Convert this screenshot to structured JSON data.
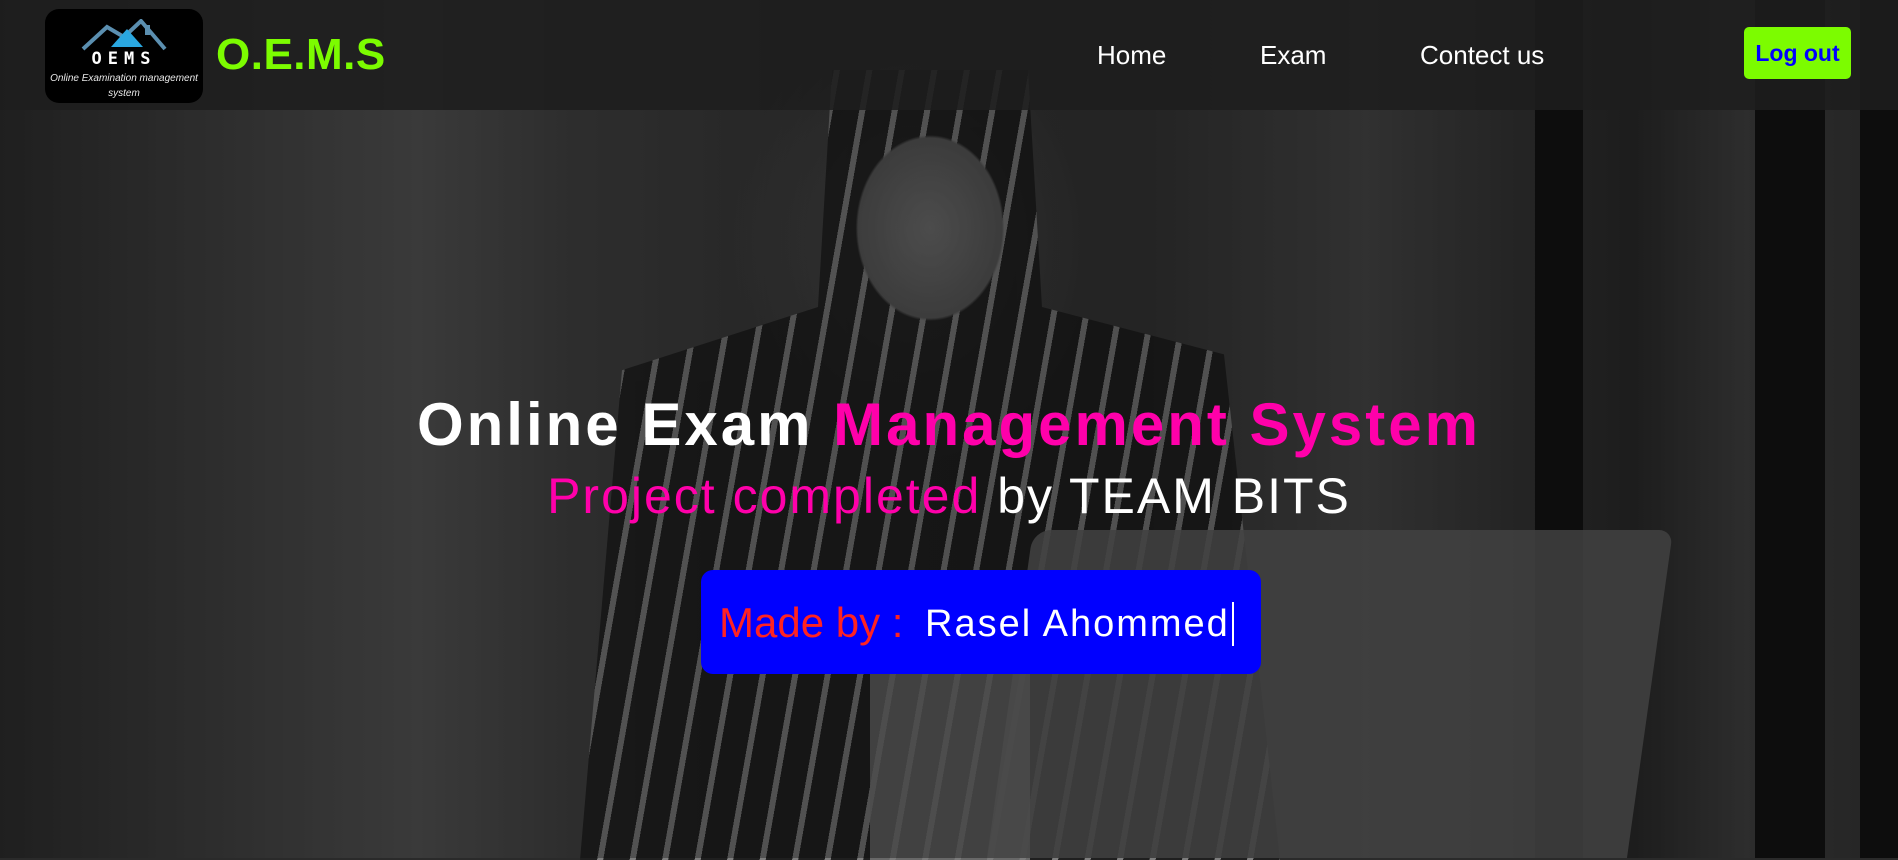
{
  "header": {
    "logo": {
      "abbr": "OEMS",
      "subtitle": "Online Examination management system"
    },
    "brand": "O.E.M.S",
    "nav": [
      {
        "label": "Home"
      },
      {
        "label": "Exam"
      },
      {
        "label": "Contect us"
      }
    ],
    "logout_label": "Log out"
  },
  "hero": {
    "title_part1": "Online Exam",
    "title_part2": "Management System",
    "subtitle_part1": "Project completed",
    "subtitle_part2": "by TEAM BITS",
    "made_by_label": "Made by :",
    "made_by_name": "Rasel Ahommed"
  },
  "colors": {
    "brand_green": "#7cfc00",
    "accent_pink": "#ff00aa",
    "made_box_blue": "#0000ff",
    "made_label_red": "#ff2222",
    "logout_text_blue": "#0000ff"
  }
}
